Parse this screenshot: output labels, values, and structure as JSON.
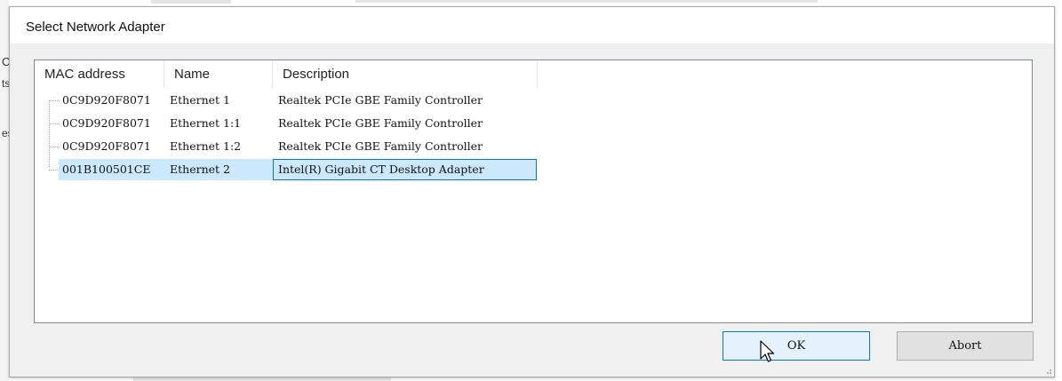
{
  "background": {
    "fragments": [
      "C",
      "ts",
      "es"
    ]
  },
  "dialog": {
    "title": "Select Network Adapter"
  },
  "list": {
    "columns": [
      "MAC address",
      "Name",
      "Description"
    ],
    "rows": [
      {
        "mac": "0C9D920F8071",
        "name": "Ethernet 1",
        "description": "Realtek PCIe GBE Family Controller",
        "selected": false
      },
      {
        "mac": "0C9D920F8071",
        "name": "Ethernet 1:1",
        "description": "Realtek PCIe GBE Family Controller",
        "selected": false
      },
      {
        "mac": "0C9D920F8071",
        "name": "Ethernet 1:2",
        "description": "Realtek PCIe GBE Family Controller",
        "selected": false
      },
      {
        "mac": "001B100501CE",
        "name": "Ethernet 2",
        "description": "Intel(R) Gigabit CT Desktop Adapter",
        "selected": true
      }
    ]
  },
  "buttons": {
    "ok": "OK",
    "abort": "Abort"
  },
  "colors": {
    "selection": "#cce8ff",
    "focus_border": "#0078d7",
    "dialog_bg": "#f0f0f0"
  },
  "icons": [
    "cursor-arrow-icon",
    "resize-grip-icon"
  ]
}
